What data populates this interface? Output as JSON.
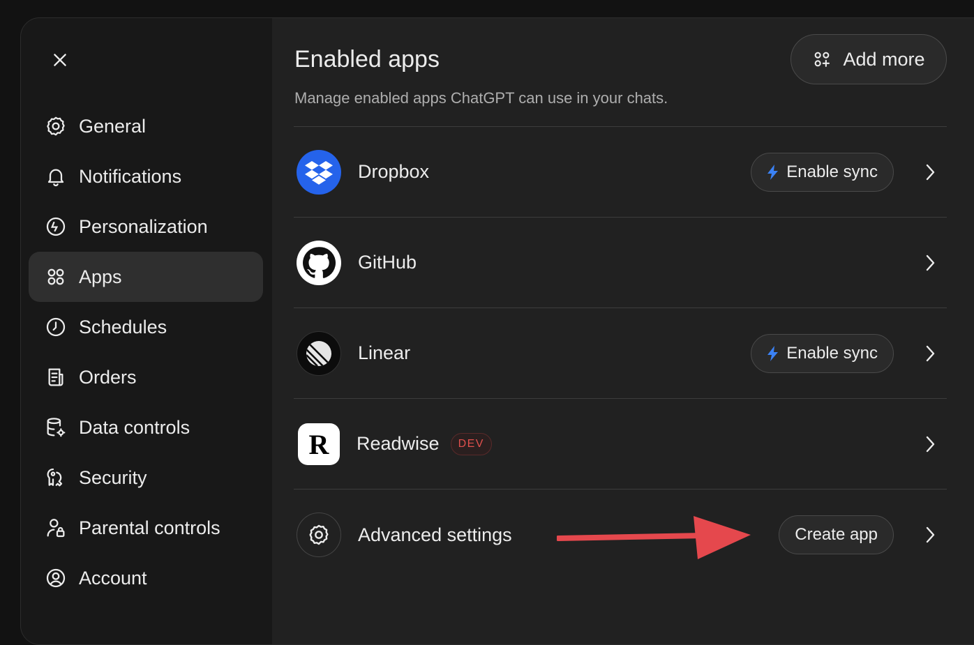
{
  "sidebar": {
    "close_label": "Close",
    "items": [
      {
        "label": "General",
        "icon": "gear-icon"
      },
      {
        "label": "Notifications",
        "icon": "bell-icon"
      },
      {
        "label": "Personalization",
        "icon": "personalization-icon"
      },
      {
        "label": "Apps",
        "icon": "apps-grid-icon",
        "active": true
      },
      {
        "label": "Schedules",
        "icon": "clock-icon"
      },
      {
        "label": "Orders",
        "icon": "receipt-icon"
      },
      {
        "label": "Data controls",
        "icon": "database-gear-icon"
      },
      {
        "label": "Security",
        "icon": "key-shield-icon"
      },
      {
        "label": "Parental controls",
        "icon": "user-lock-icon"
      },
      {
        "label": "Account",
        "icon": "user-circle-icon"
      }
    ]
  },
  "main": {
    "title": "Enabled apps",
    "subtitle": "Manage enabled apps ChatGPT can use in your chats.",
    "add_more_label": "Add more",
    "apps": [
      {
        "name": "Dropbox",
        "icon": "dropbox-logo",
        "action": "Enable sync"
      },
      {
        "name": "GitHub",
        "icon": "github-logo"
      },
      {
        "name": "Linear",
        "icon": "linear-logo",
        "action": "Enable sync"
      },
      {
        "name": "Readwise",
        "icon": "readwise-logo",
        "badge": "DEV"
      },
      {
        "name": "Advanced settings",
        "icon": "gear-icon",
        "action": "Create app"
      }
    ]
  },
  "colors": {
    "background": "#212121",
    "sidebar": "#181818",
    "active_item": "#2f2f2f",
    "dropbox_blue": "#2563eb",
    "sync_bolt": "#3b82f6",
    "dev_badge": "#e0504d",
    "annotation_arrow": "#e5484d"
  }
}
